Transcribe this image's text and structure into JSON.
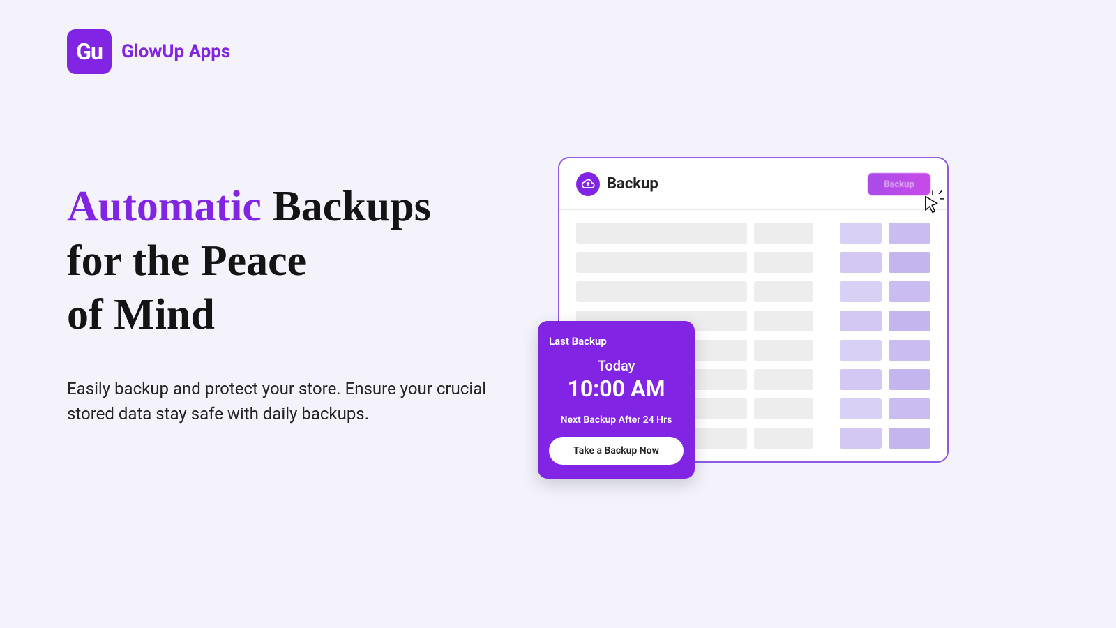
{
  "brand": {
    "mark_text": "Gu",
    "name": "GlowUp Apps"
  },
  "hero": {
    "headline_accent": "Automatic",
    "headline_rest_line1": " Backups",
    "headline_line2": "for the Peace",
    "headline_line3": "of Mind",
    "body": "Easily backup and protect your store. Ensure your crucial stored data stay safe with daily backups."
  },
  "app": {
    "title": "Backup",
    "header_button": "Backup",
    "icon_name": "cloud-upload-icon"
  },
  "status": {
    "label": "Last Backup",
    "day": "Today",
    "time": "10:00 AM",
    "next": "Next Backup After 24 Hrs",
    "action": "Take a Backup Now"
  },
  "colors": {
    "brand_purple": "#8224e3",
    "bg": "#f4f3fc"
  }
}
